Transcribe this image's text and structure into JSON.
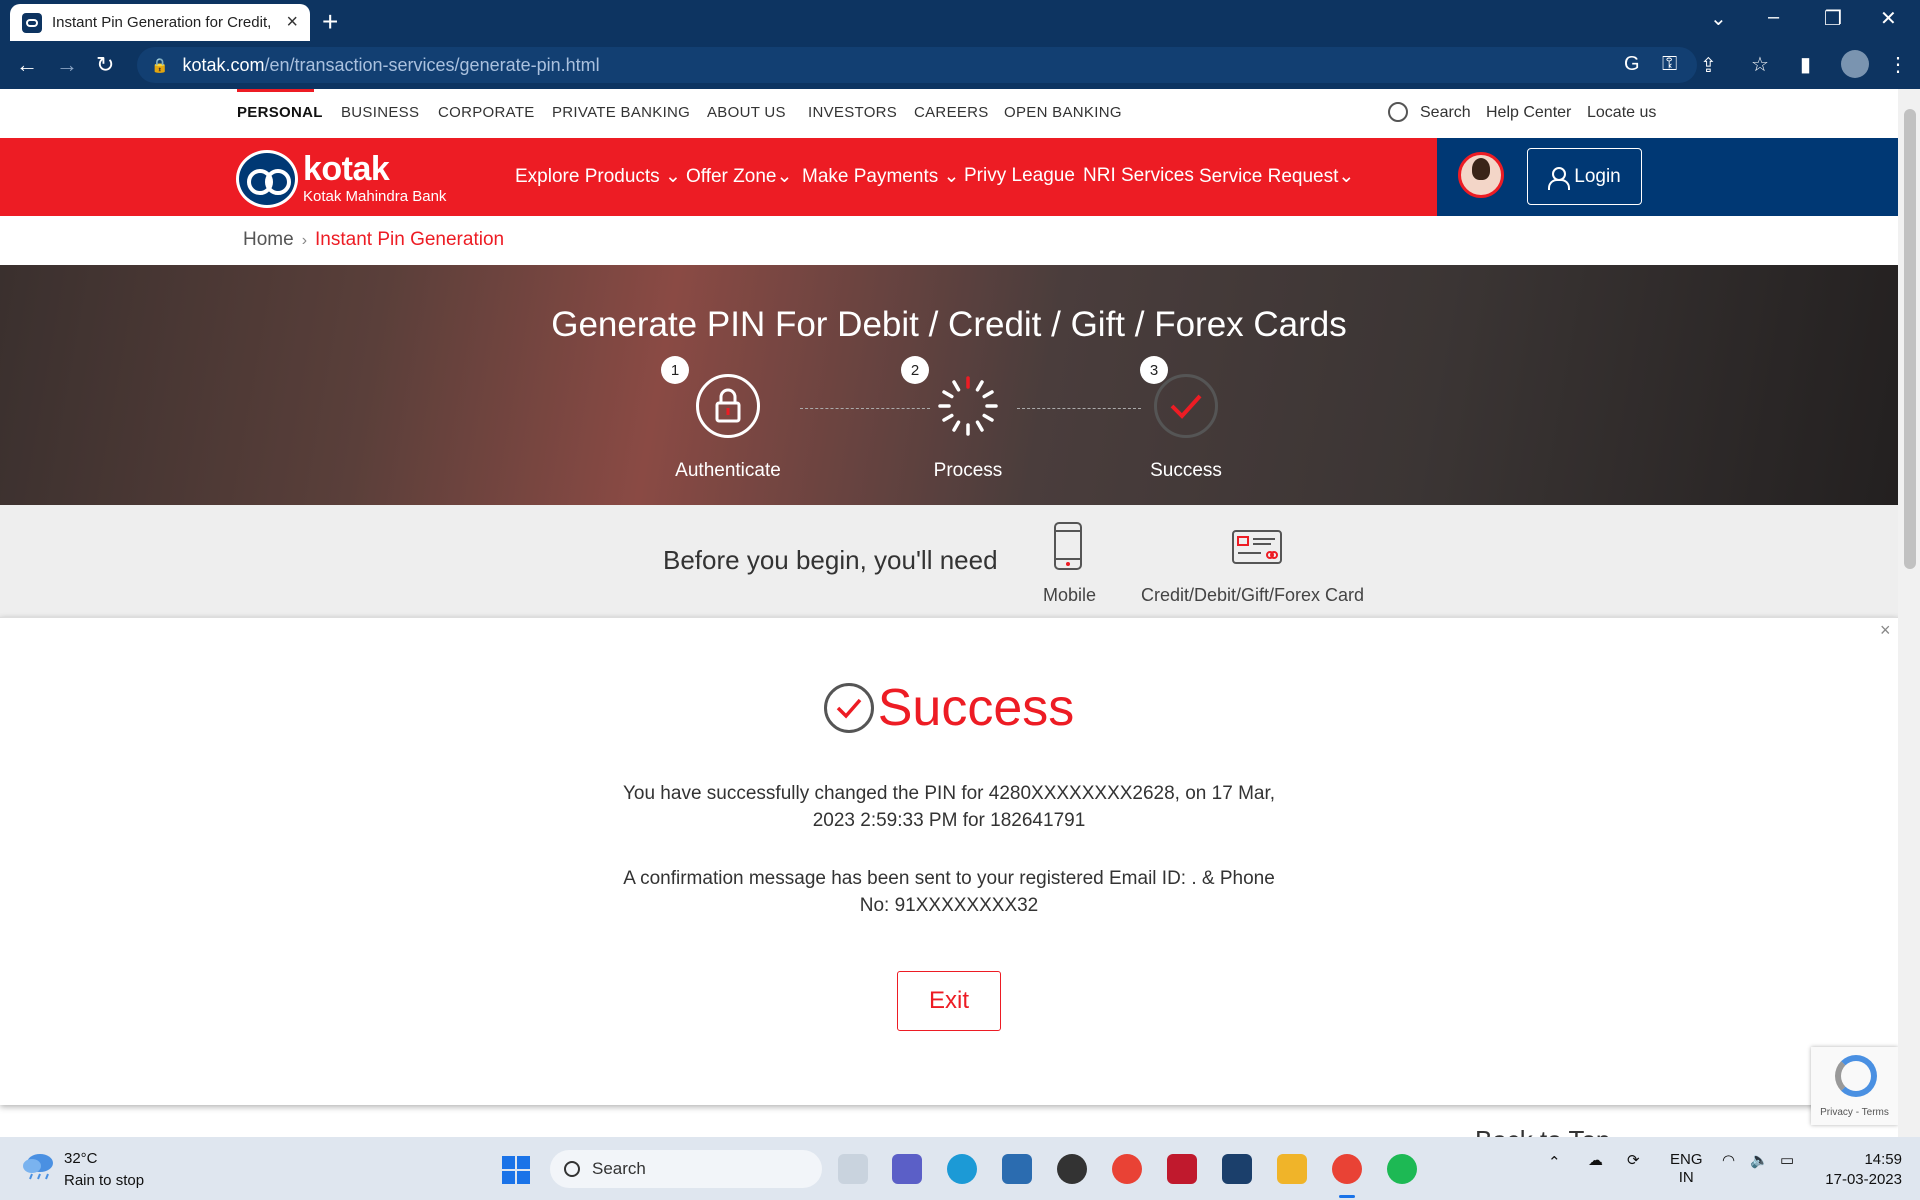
{
  "browser": {
    "tab_title": "Instant Pin Generation for Credit,",
    "url_host": "kotak.com",
    "url_path": "/en/transaction-services/generate-pin.html"
  },
  "topnav": {
    "items": [
      "PERSONAL",
      "BUSINESS",
      "CORPORATE",
      "PRIVATE BANKING",
      "ABOUT US",
      "INVESTORS",
      "CAREERS",
      "OPEN BANKING"
    ],
    "search_label": "Search",
    "help_label": "Help Center",
    "locate_label": "Locate us"
  },
  "header": {
    "logo_text": "kotak",
    "logo_sub": "Kotak Mahindra Bank",
    "nav": [
      "Explore Products",
      "Offer Zone",
      "Make Payments",
      "Privy League",
      "NRI Services",
      "Service Request"
    ],
    "login_label": "Login"
  },
  "breadcrumb": {
    "home": "Home",
    "current": "Instant Pin Generation"
  },
  "hero": {
    "title": "Generate PIN For Debit / Credit / Gift / Forex Cards",
    "steps": [
      {
        "num": "1",
        "label": "Authenticate"
      },
      {
        "num": "2",
        "label": "Process"
      },
      {
        "num": "3",
        "label": "Success"
      }
    ]
  },
  "before": {
    "text": "Before you begin, you'll need",
    "items": [
      "Mobile",
      "Credit/Debit/Gift/Forex Card"
    ]
  },
  "modal": {
    "title": "Success",
    "line1": "You have successfully changed the PIN for 4280XXXXXXXX2628, on 17 Mar,",
    "line2": "2023 2:59:33 PM for 182641791",
    "line3": "A confirmation message has been sent to your registered Email ID: . & Phone",
    "line4": "No: 91XXXXXXXX32",
    "exit_label": "Exit"
  },
  "recaptcha": {
    "text": "Privacy - Terms"
  },
  "back_to_top": "Back to Top",
  "taskbar": {
    "temp": "32°C",
    "weather": "Rain to stop",
    "search": "Search",
    "lang1": "ENG",
    "lang2": "IN",
    "time": "14:59",
    "date": "17-03-2023"
  },
  "colors": {
    "brand_red": "#ed1c24",
    "brand_blue": "#003874",
    "chrome_blue": "#0d3461"
  }
}
